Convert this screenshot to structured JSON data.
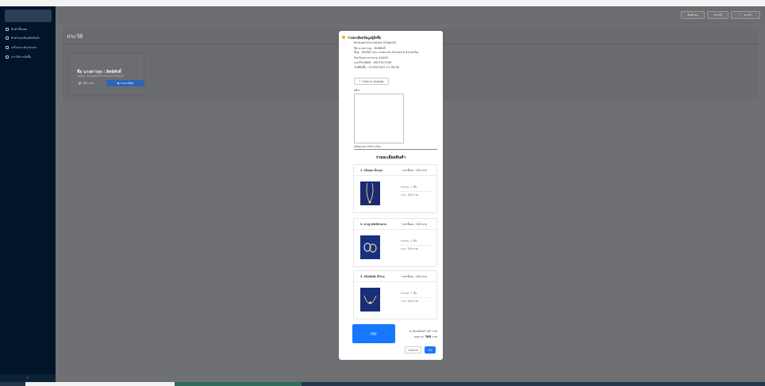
{
  "header": {
    "buttons": [
      {
        "label": "สินค้าคง"
      },
      {
        "label": "ประวัติ"
      },
      {
        "label": "ตะกร้า"
      }
    ]
  },
  "sidebar": {
    "items": [
      {
        "label": "สินค้าทั้งหมด",
        "icon": "user-icon"
      },
      {
        "label": "สินค้าคงคลัง/ผลิตสินค้า",
        "icon": "user-icon"
      },
      {
        "label": "เครื่องประดับ/ตกแต่ง",
        "icon": "setting-icon"
      },
      {
        "label": "ประวัติการสั่งซื้อ",
        "icon": "setting-icon"
      }
    ],
    "collapse": "‹"
  },
  "page": {
    "title": "ประวัติ",
    "order_card": {
      "name": "ชื่อ นางสาวจุล : สิทธิศักดิ์",
      "id": "รหัสสั่ง : 643cae2951c3d1d2 f53bd2f3",
      "total": "785 บาท",
      "detail_button": "รายละเอียด"
    }
  },
  "modal": {
    "title": "รายละเอียดข้อมูลผู้สั่งซื้อ",
    "lines": [
      "643cae2951c3d1d2 f53bd2f3",
      "ชื่อ นางสาวจุล : สิทธิศักดิ์",
      "ที่อยู่ : 185/6/3 ถนน ทาเพนะเงิน ตำบลตลาด อำเภอเมือง",
      "จังหวัดมหาสารคาม 44000",
      "เบอร์โทรศัพท์ : 0823317496",
      "วันที่สั่งซื้อ : 07/05/2022 21:36:36"
    ],
    "upload_label": "Click to Upload",
    "slip_label": "สลิป",
    "payment_label": "หลักฐานการชำระเงิน :",
    "detail_title": "รายละเอียดสินค้า",
    "products": [
      {
        "name": "1. สร้อยคอ เอ็นบอล",
        "price": "ราคาชิ้นละ : 200 บาท",
        "qty": "จำนวน : 1 ชิ้น",
        "sum": "รวม : 200 บาท"
      },
      {
        "name": "2. ต่างหู เพชรสีสวยงาม",
        "price": "ราคาชิ้นละ : 200 บาท",
        "qty": "จำนวน : 1 ชิ้น",
        "sum": "รวม : 200 บาท"
      },
      {
        "name": "3. สร้อยข้อมือ ฮีโรแล",
        "price": "ราคาชิ้นละ : 200 บาท",
        "qty": "จำนวน : 1 ชิ้น",
        "sum": "รวม : 200 บาท"
      }
    ],
    "pdf_label": "PDF",
    "shipping": "ค่าจัดส่งสินค้า 85 บาท",
    "total_prefix": "ยอดรวม ",
    "total_value": "785",
    "total_suffix": " บาท",
    "cancel": "Cancel",
    "ok": "OK"
  },
  "colors": {
    "primary": "#1677ff",
    "warning": "#f5b017",
    "sidebar": "#001529"
  }
}
